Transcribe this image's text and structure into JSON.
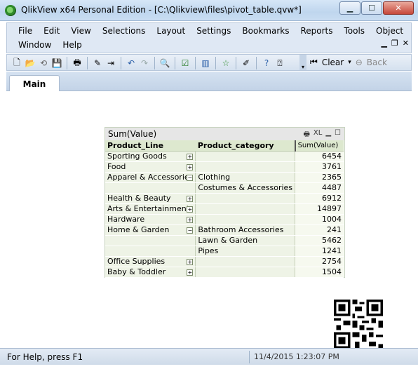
{
  "window": {
    "title": "QlikView x64 Personal Edition - [C:\\Qlikview\\files\\pivot_table.qvw*]",
    "buttons": {
      "minimize": "▁",
      "maximize": "☐",
      "close": "✕"
    }
  },
  "menu": {
    "row1": [
      "File",
      "Edit",
      "View",
      "Selections",
      "Layout",
      "Settings",
      "Bookmarks",
      "Reports",
      "Tools",
      "Object"
    ],
    "row2": [
      "Window",
      "Help"
    ]
  },
  "toolbar": {
    "clear_label": "Clear",
    "back_label": "Back"
  },
  "tabs": [
    {
      "label": "Main"
    }
  ],
  "pivot": {
    "caption": "Sum(Value)",
    "caption_xl": "XL",
    "headers": [
      "Product_Line",
      "Product_category",
      "Sum(Value)"
    ],
    "rows": [
      {
        "line": "Sporting Goods",
        "toggle": "+",
        "category": "",
        "value": "6454"
      },
      {
        "line": "Food",
        "toggle": "+",
        "category": "",
        "value": "3761"
      },
      {
        "line": "Apparel & Accessories",
        "toggle": "−",
        "category": "Clothing",
        "value": "2365"
      },
      {
        "line": "",
        "toggle": "",
        "category": "Costumes & Accessories",
        "value": "4487"
      },
      {
        "line": "Health & Beauty",
        "toggle": "+",
        "category": "",
        "value": "6912"
      },
      {
        "line": "Arts & Entertainment",
        "toggle": "+",
        "category": "",
        "value": "14897"
      },
      {
        "line": "Hardware",
        "toggle": "+",
        "category": "",
        "value": "1004"
      },
      {
        "line": "Home & Garden",
        "toggle": "−",
        "category": "Bathroom Accessories",
        "value": "241"
      },
      {
        "line": "",
        "toggle": "",
        "category": "Lawn & Garden",
        "value": "5462"
      },
      {
        "line": "",
        "toggle": "",
        "category": "Pipes",
        "value": "1241"
      },
      {
        "line": "Office Supplies",
        "toggle": "+",
        "category": "",
        "value": "2754"
      },
      {
        "line": "Baby & Toddler",
        "toggle": "+",
        "category": "",
        "value": "1504"
      }
    ]
  },
  "status": {
    "help": "For Help, press F1",
    "timestamp": "11/4/2015 1:23:07 PM"
  }
}
